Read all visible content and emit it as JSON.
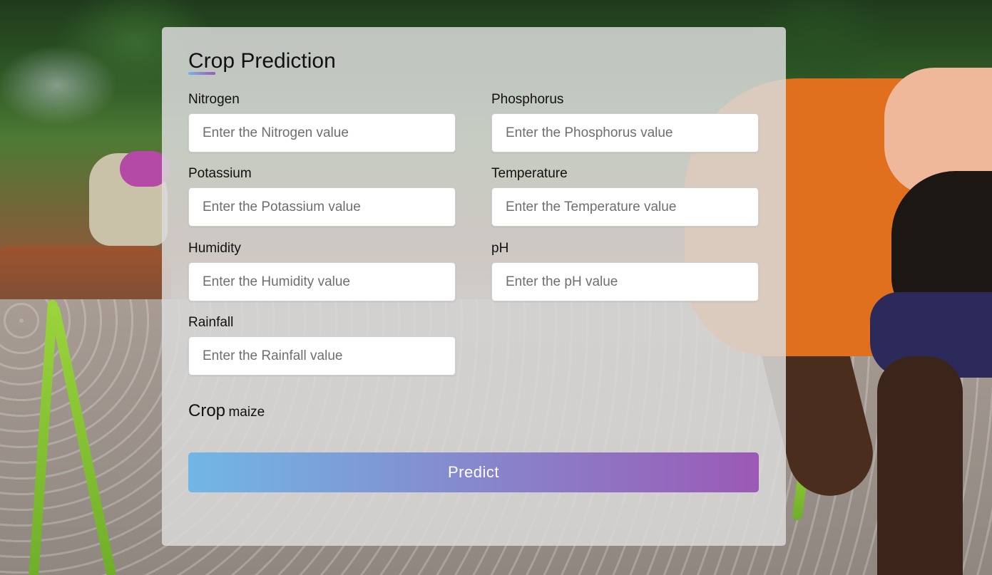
{
  "page": {
    "title": "Crop Prediction"
  },
  "form": {
    "fields": [
      {
        "label": "Nitrogen",
        "placeholder": "Enter the Nitrogen value",
        "value": ""
      },
      {
        "label": "Phosphorus",
        "placeholder": "Enter the Phosphorus value",
        "value": ""
      },
      {
        "label": "Potassium",
        "placeholder": "Enter the Potassium value",
        "value": ""
      },
      {
        "label": "Temperature",
        "placeholder": "Enter the Temperature value",
        "value": ""
      },
      {
        "label": "Humidity",
        "placeholder": "Enter the Humidity value",
        "value": ""
      },
      {
        "label": "pH",
        "placeholder": "Enter the pH value",
        "value": ""
      },
      {
        "label": "Rainfall",
        "placeholder": "Enter the Rainfall value",
        "value": ""
      }
    ]
  },
  "result": {
    "label": "Crop",
    "value": "maize"
  },
  "actions": {
    "predict_label": "Predict"
  },
  "colors": {
    "button_gradient_start": "#71b7e6",
    "button_gradient_end": "#9b59b6",
    "card_background": "#dadada"
  }
}
